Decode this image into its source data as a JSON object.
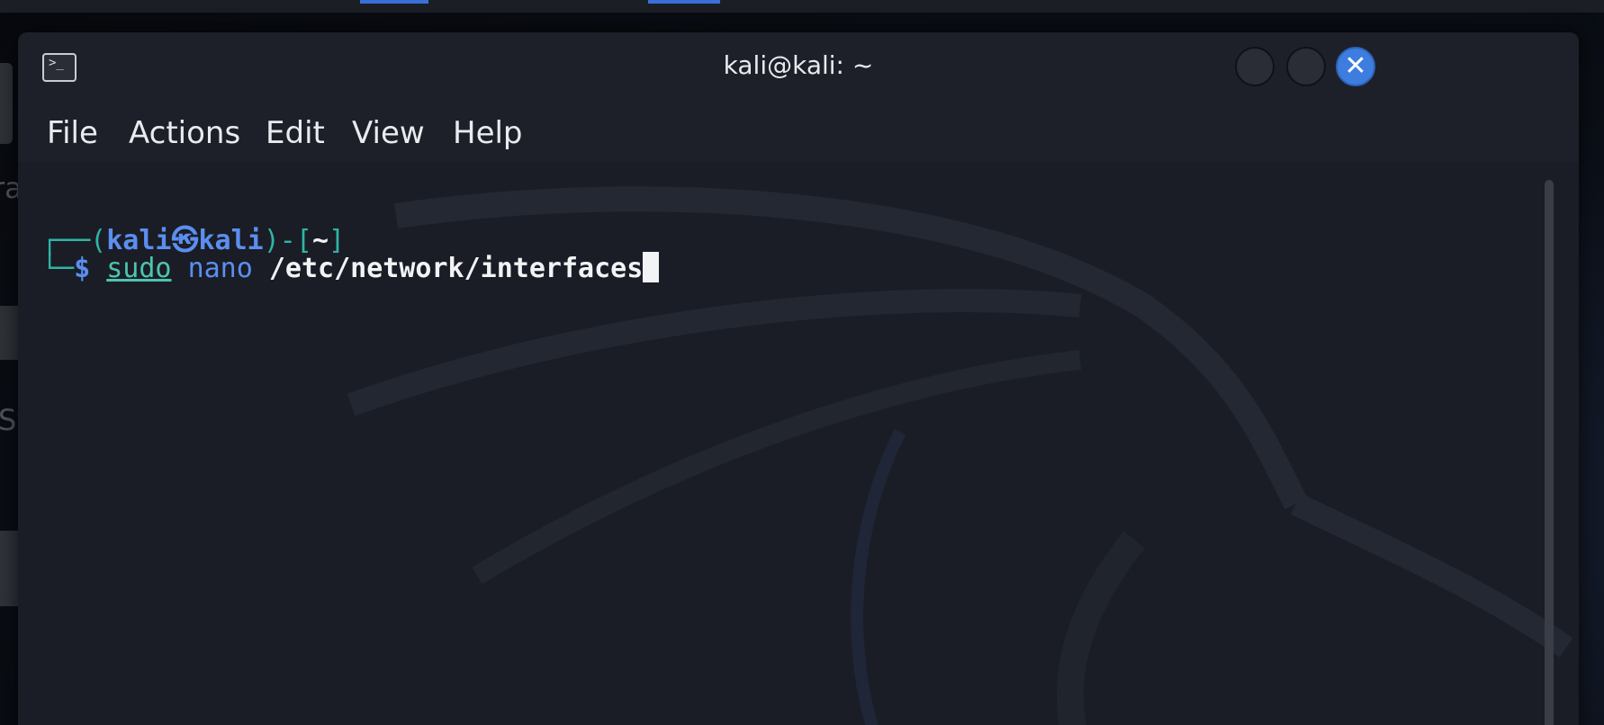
{
  "window": {
    "title": "kali@kali: ~",
    "icons": {
      "app": "terminal-icon",
      "minimize": "minimize-icon",
      "maximize": "maximize-icon",
      "close": "close-icon"
    },
    "close_glyph": "✕"
  },
  "menu": {
    "items": [
      {
        "label": "File"
      },
      {
        "label": "Actions"
      },
      {
        "label": "Edit"
      },
      {
        "label": "View"
      },
      {
        "label": "Help"
      }
    ]
  },
  "desktop": {
    "labels": [
      "rash",
      "System"
    ]
  },
  "terminal": {
    "prompt": {
      "open": "┌──(",
      "user": "kali",
      "symbol": "㉿",
      "host": "kali",
      "mid": ")-[",
      "dir": "~",
      "close": "]",
      "line2_prefix": "└─",
      "dollar": "$"
    },
    "command": {
      "cmd": "sudo",
      "arg1": "nano",
      "path": "/etc/network/interfaces"
    }
  },
  "colors": {
    "window_bg": "#1d2029",
    "terminal_bg": "#1a1d25",
    "accent": "#3d7de0",
    "prompt_teal": "#2fb4a6",
    "prompt_blue": "#5b8ef0"
  }
}
